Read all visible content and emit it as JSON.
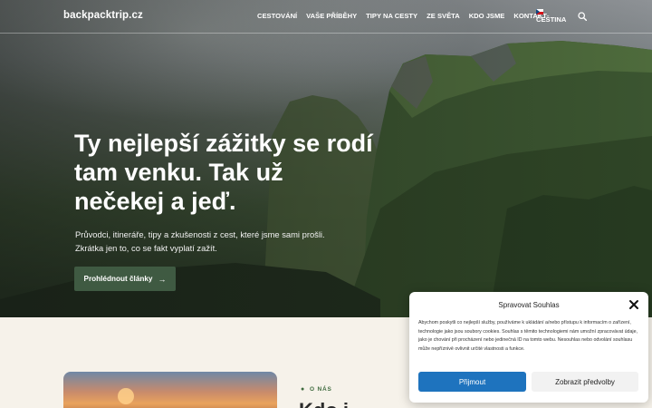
{
  "header": {
    "logo": "backpacktrip.cz",
    "nav": [
      "CESTOVÁNÍ",
      "VAŠE PŘÍBĚHY",
      "TIPY NA CESTY",
      "ZE SVĚTA",
      "KDO JSME",
      "KONTAKT"
    ],
    "language": "ČEŠTINA",
    "search_icon": "search-icon",
    "flag_icon": "czech-flag-icon"
  },
  "hero": {
    "title": "Ty nejlepší zážitky se rodí tam venku. Tak už nečekej a jeď.",
    "subtitle_line1": "Průvodci, itineráře, tipy a zkušenosti z cest, které jsme sami prošli.",
    "subtitle_line2": "Zkrátka jen to, co se fakt vyplatí zažít.",
    "button_label": "Prohlédnout články",
    "button_icon": "arrow-right-icon"
  },
  "about": {
    "label": "O NÁS",
    "label_icon": "pin-icon",
    "heading": "Kdo j"
  },
  "consent": {
    "title": "Spravovat Souhlas",
    "body": "Abychom poskytli co nejlepší služby, používáme k ukládání a/nebo přístupu k informacím o zařízení, technologie jako jsou soubory cookies. Souhlas s těmito technologiemi nám umožní zpracovávat údaje, jako je chování při procházení nebo jedinečná ID na tomto webu. Nesouhlas nebo odvolání souhlasu může nepříznivě ovlivnit určité vlastnosti a funkce.",
    "accept_label": "Přijmout",
    "preferences_label": "Zobrazit předvolby",
    "close_icon": "close-icon",
    "accept_color": "#1e73be"
  },
  "colors": {
    "accent_green": "#3f5a42",
    "page_background": "#f6f2ea"
  }
}
